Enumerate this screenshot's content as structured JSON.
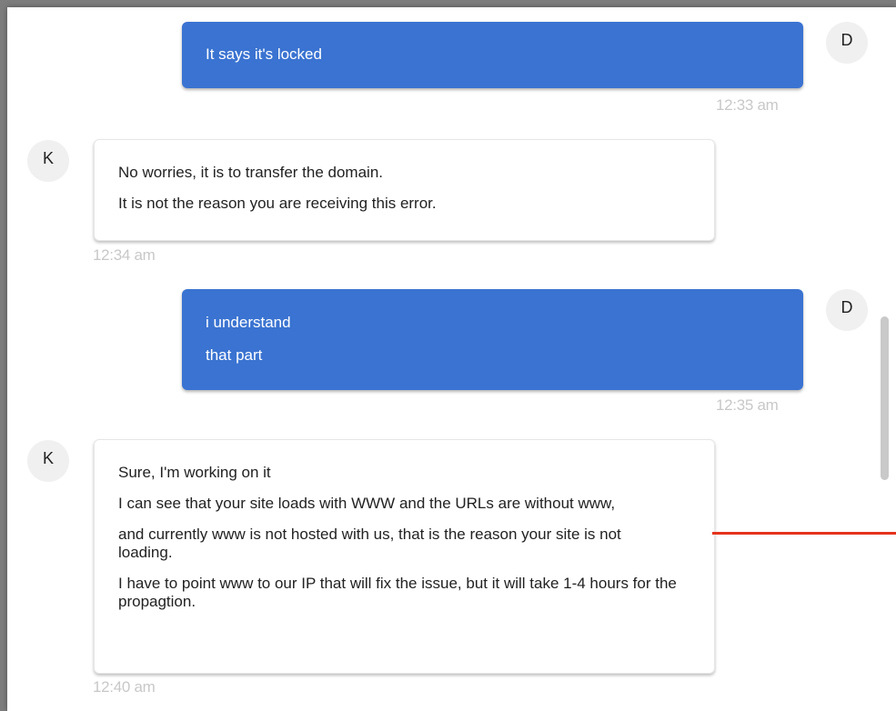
{
  "messages": [
    {
      "sender": "D",
      "lines": [
        "It says it's locked"
      ],
      "time": "12:33 am"
    },
    {
      "sender": "K",
      "lines": [
        "No worries, it is to transfer the domain.",
        "It is not the reason you are receiving this error."
      ],
      "time": "12:34 am"
    },
    {
      "sender": "D",
      "lines": [
        "i understand",
        "that part"
      ],
      "time": "12:35 am"
    },
    {
      "sender": "K",
      "lines": [
        "Sure, I'm working on it",
        "I can see that your site loads with WWW and the URLs are without www,",
        "and currently www is not hosted with us, that is the reason your site is not loading.",
        "I have to point www to our IP that will fix the issue, but it will take 1-4 hours for the propagtion."
      ],
      "time": "12:40 am"
    }
  ],
  "colors": {
    "sent_bubble": "#3a73d1",
    "annotation_line": "#e5321c"
  }
}
